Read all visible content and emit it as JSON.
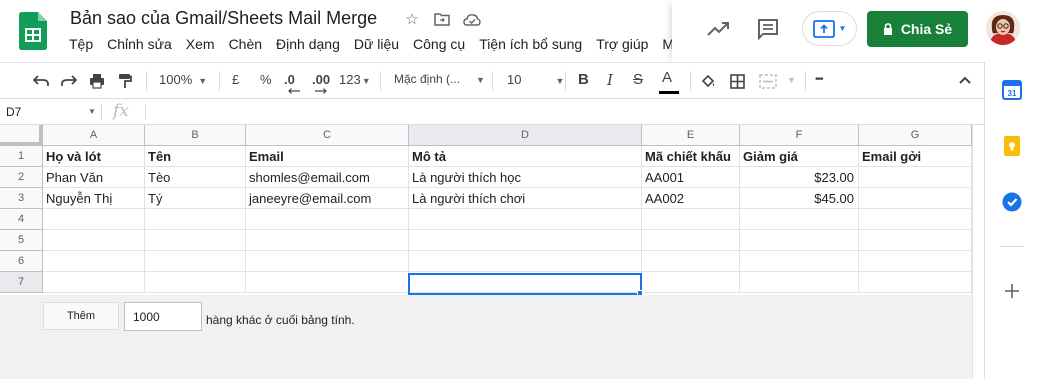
{
  "header": {
    "title": "Bản sao của Gmail/Sheets Mail Merge",
    "menu": [
      "Tệp",
      "Chỉnh sửa",
      "Xem",
      "Chèn",
      "Định dạng",
      "Dữ liệu",
      "Công cụ",
      "Tiện ích bổ sung",
      "Trợ giúp",
      "M"
    ],
    "share_label": "Chia Sẻ"
  },
  "toolbar": {
    "zoom": "100%",
    "currency": "£",
    "percent": "%",
    "dec_less": ".0",
    "dec_more": ".00",
    "format_more": "123",
    "font": "Mặc định (...",
    "font_size": "10",
    "bold": "B",
    "italic": "I",
    "strike": "S",
    "text_color": "A",
    "more": "•••"
  },
  "formula_bar": {
    "name_box": "D7",
    "fx": "fx",
    "value": ""
  },
  "sheet": {
    "columns": [
      "A",
      "B",
      "C",
      "D",
      "E",
      "F",
      "G"
    ],
    "rows": [
      "1",
      "2",
      "3",
      "4",
      "5",
      "6",
      "7"
    ],
    "cells": [
      [
        "Họ và lót",
        "Tên",
        "Email",
        "Mô tả",
        "Mã chiết khấu",
        "Giảm giá",
        "Email gởi"
      ],
      [
        "Phan Văn",
        "Tèo",
        "shomles@email.com",
        "Là người thích học",
        "AA001",
        "$23.00",
        ""
      ],
      [
        "Nguyễn Thị",
        "Tý",
        "janeeyre@email.com",
        "Là người thích chơi",
        "AA002",
        "$45.00",
        ""
      ],
      [
        "",
        "",
        "",
        "",
        "",
        "",
        ""
      ],
      [
        "",
        "",
        "",
        "",
        "",
        "",
        ""
      ],
      [
        "",
        "",
        "",
        "",
        "",
        "",
        ""
      ],
      [
        "",
        "",
        "",
        "",
        "",
        "",
        ""
      ]
    ],
    "selected_cell": "D7"
  },
  "footer": {
    "add_button": "Thêm",
    "rows_value": "1000",
    "rows_text": "hàng khác ở cuối bảng tính."
  },
  "colors": {
    "accent_green": "#188038",
    "selection_blue": "#1a73e8"
  }
}
